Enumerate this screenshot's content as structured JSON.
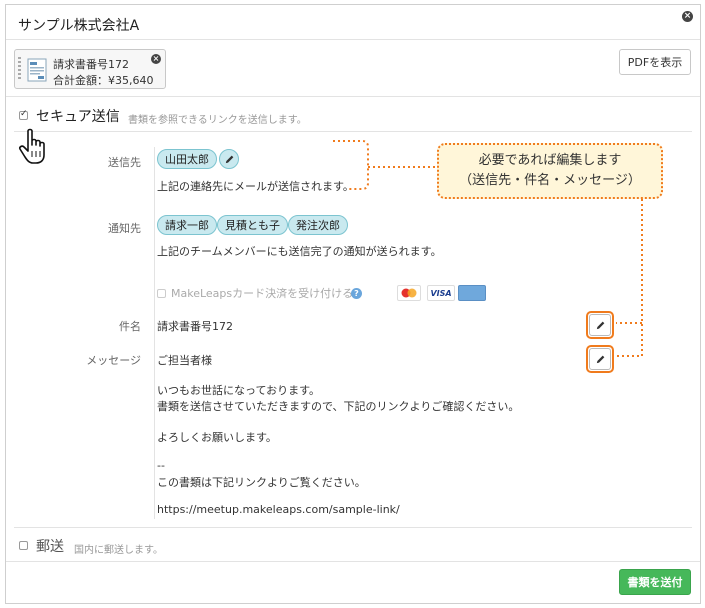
{
  "dialog": {
    "title": "サンプル株式会社A"
  },
  "document": {
    "name": "請求書番号172",
    "total": "合計金額：¥35,640"
  },
  "toolbar": {
    "pdf_label": "PDFを表示"
  },
  "secure": {
    "label": "セキュア送信",
    "description": "書類を参照できるリンクを送信します。",
    "checked": true
  },
  "recipient": {
    "label": "送信先",
    "pill": "山田太郎",
    "note": "上記の連絡先にメールが送信されます。"
  },
  "notify": {
    "label": "通知先",
    "pills": [
      "請求一郎",
      "見積とも子",
      "発注次郎"
    ],
    "note": "上記のチームメンバーにも送信完了の通知が送られます。"
  },
  "card_payment": {
    "label": "MakeLeapsカード決済を受け付ける",
    "cards": [
      "mastercard",
      "VISA",
      "AMEX"
    ]
  },
  "subject": {
    "label": "件名",
    "value": "請求書番号172"
  },
  "message": {
    "label": "メッセージ",
    "lines": [
      "ご担当者様",
      "いつもお世話になっております。",
      "書類を送信させていただきますので、下記のリンクよりご確認ください。",
      "よろしくお願いします。",
      "--",
      "この書類は下記リンクよりご覧ください。",
      "https://meetup.makeleaps.com/sample-link/"
    ]
  },
  "callout": {
    "line1": "必要であれば編集します",
    "line2": "（送信先・件名・メッセージ）"
  },
  "postal": {
    "label": "郵送",
    "description": "国内に郵送します。",
    "checked": false
  },
  "actions": {
    "send_label": "書類を送付"
  },
  "colors": {
    "accent_orange": "#f07b1d",
    "pill_bg": "#c9e9ef",
    "send_green": "#46b85a"
  }
}
